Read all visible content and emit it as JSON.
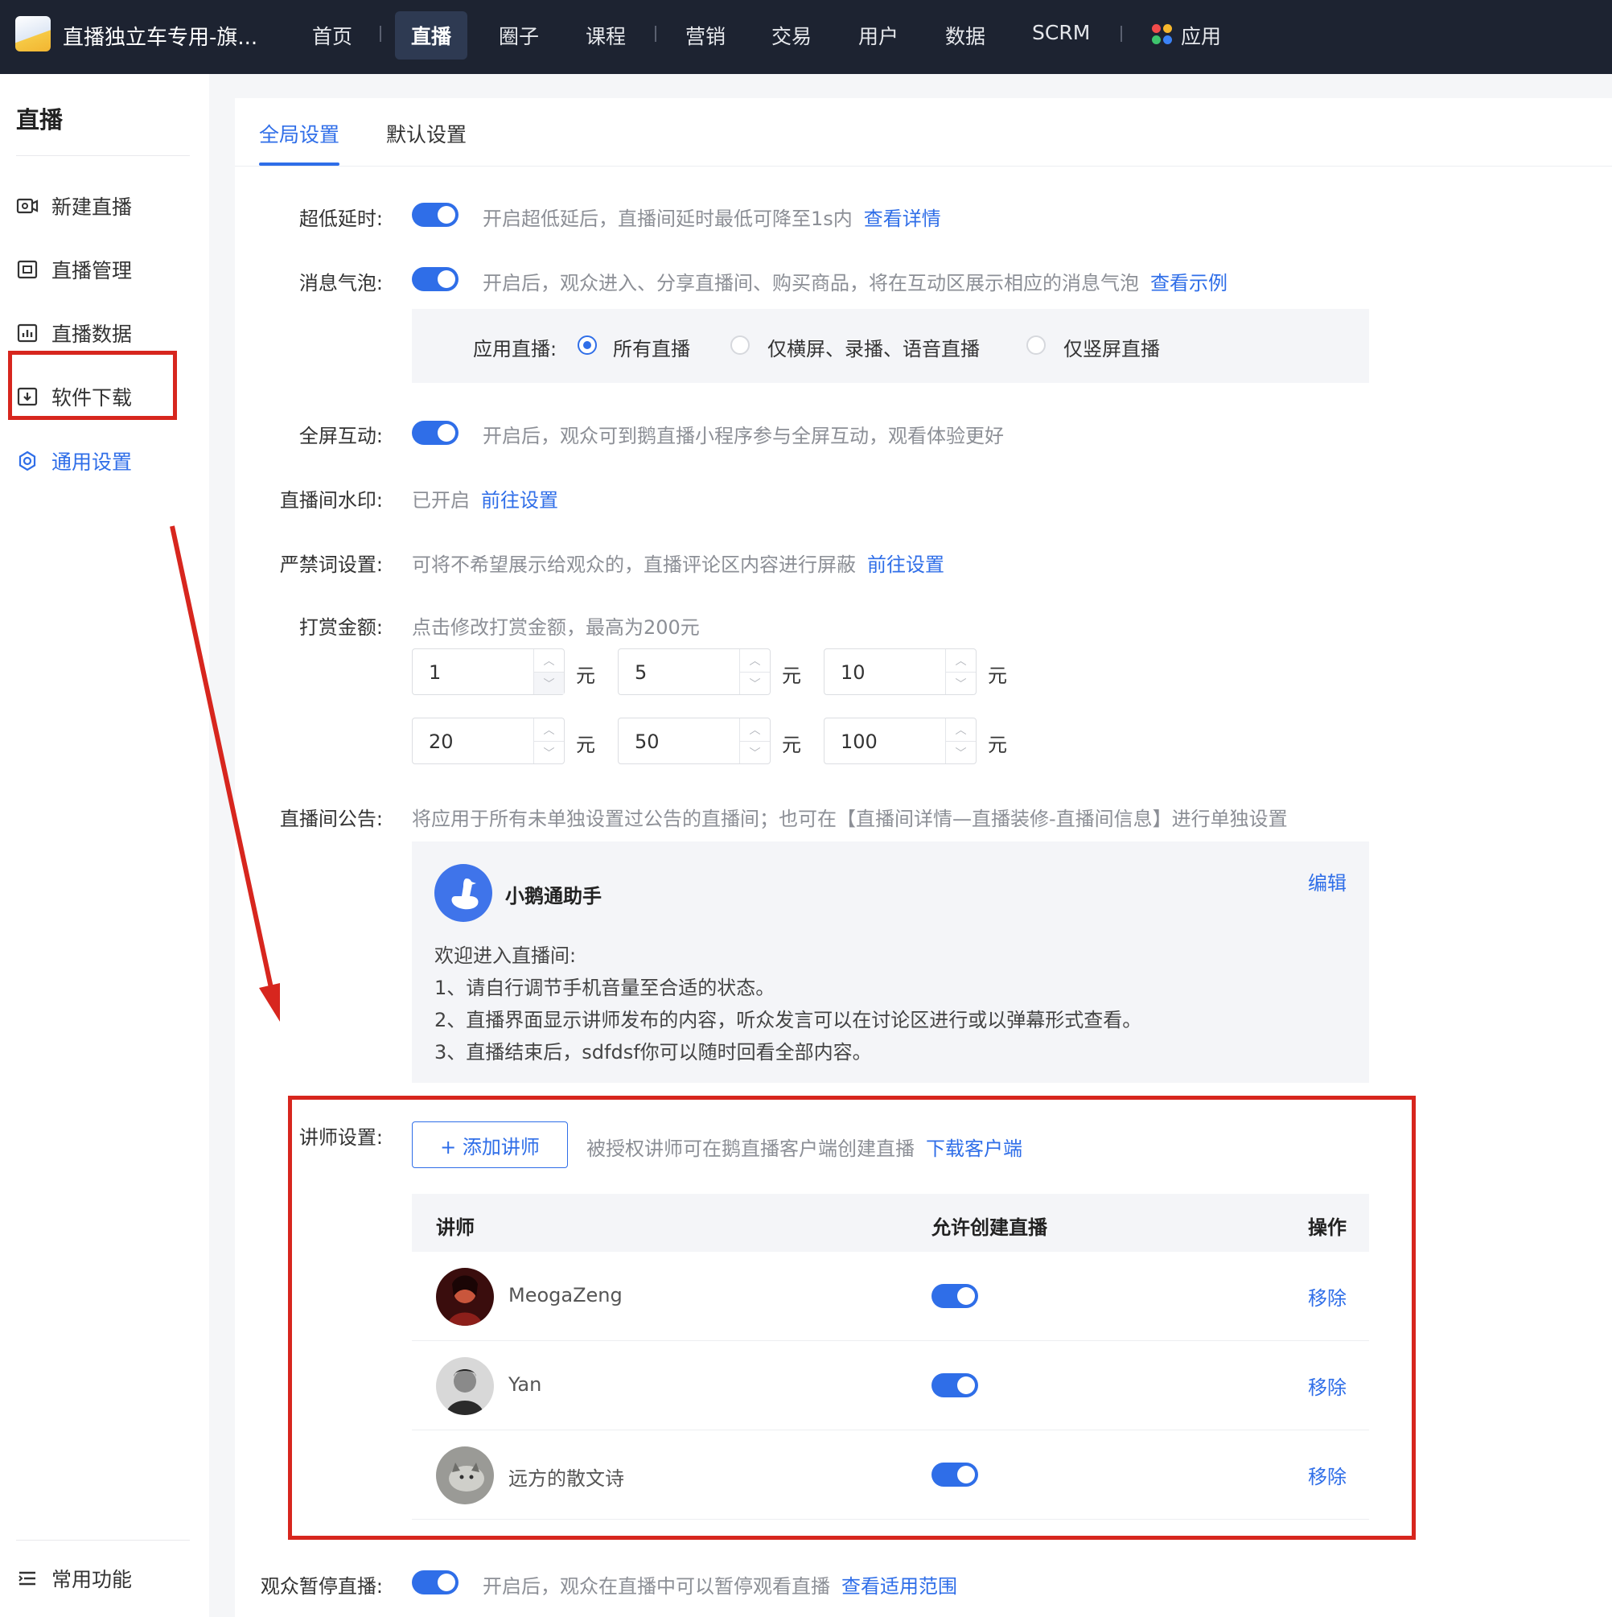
{
  "header": {
    "shop_name": "直播独立车专用-旗...",
    "nav": [
      "首页",
      "直播",
      "圈子",
      "课程",
      "营销",
      "交易",
      "用户",
      "数据",
      "SCRM",
      "应用"
    ],
    "active_nav": "直播"
  },
  "sidebar": {
    "title": "直播",
    "items": [
      {
        "label": "新建直播",
        "icon": "video-add-icon"
      },
      {
        "label": "直播管理",
        "icon": "live-manage-icon"
      },
      {
        "label": "直播数据",
        "icon": "bar-chart-icon"
      },
      {
        "label": "软件下载",
        "icon": "download-icon"
      },
      {
        "label": "通用设置",
        "icon": "gear-icon"
      }
    ],
    "active_item": "通用设置",
    "bottom_item": {
      "label": "常用功能",
      "icon": "list-icon"
    }
  },
  "tabs": [
    {
      "label": "全局设置",
      "active": true
    },
    {
      "label": "默认设置",
      "active": false
    }
  ],
  "settings": {
    "ultra_low_latency": {
      "label": "超低延时:",
      "enabled": true,
      "desc": "开启超低延后，直播间延时最低可降至1s内",
      "link": "查看详情"
    },
    "message_bubble": {
      "label": "消息气泡:",
      "enabled": true,
      "desc": "开启后，观众进入、分享直播间、购买商品，将在互动区展示相应的消息气泡",
      "link": "查看示例",
      "apply_label": "应用直播:",
      "options": [
        "所有直播",
        "仅横屏、录播、语音直播",
        "仅竖屏直播"
      ],
      "selected": "所有直播"
    },
    "fullscreen_interaction": {
      "label": "全屏互动:",
      "enabled": true,
      "desc": "开启后，观众可到鹅直播小程序参与全屏互动，观看体验更好"
    },
    "watermark": {
      "label": "直播间水印:",
      "status": "已开启",
      "link": "前往设置"
    },
    "banned_words": {
      "label": "严禁词设置:",
      "desc": "可将不希望展示给观众的，直播评论区内容进行屏蔽",
      "link": "前往设置"
    },
    "reward": {
      "label": "打赏金额:",
      "desc": "点击修改打赏金额，最高为200元",
      "amounts": [
        "1",
        "5",
        "10",
        "20",
        "50",
        "100"
      ],
      "unit": "元"
    },
    "notice": {
      "label": "直播间公告:",
      "desc": "将应用于所有未单独设置过公告的直播间；也可在【直播间详情—直播装修-直播间信息】进行单独设置",
      "author": "小鹅通助手",
      "edit": "编辑",
      "lines": [
        "欢迎进入直播间:",
        "1、请自行调节手机音量至合适的状态。",
        "2、直播界面显示讲师发布的内容，听众发言可以在讨论区进行或以弹幕形式查看。",
        "3、直播结束后，sdfdsf你可以随时回看全部内容。"
      ]
    },
    "lecturers": {
      "label": "讲师设置:",
      "add_button": "+ 添加讲师",
      "desc": "被授权讲师可在鹅直播客户端创建直播",
      "link": "下载客户端",
      "columns": [
        "讲师",
        "允许创建直播",
        "操作"
      ],
      "rows": [
        {
          "name": "MeogaZeng",
          "allow": true,
          "action": "移除"
        },
        {
          "name": "Yan",
          "allow": true,
          "action": "移除"
        },
        {
          "name": "远方的散文诗",
          "allow": true,
          "action": "移除"
        }
      ]
    },
    "audience_pause": {
      "label": "观众暂停直播:",
      "enabled": true,
      "desc": "开启后，观众在直播中可以暂停观看直播",
      "link": "查看适用范围"
    }
  },
  "colors": {
    "accent": "#2f6ee8",
    "annotation_red": "#d7261e",
    "topbar": "#1d2331"
  }
}
